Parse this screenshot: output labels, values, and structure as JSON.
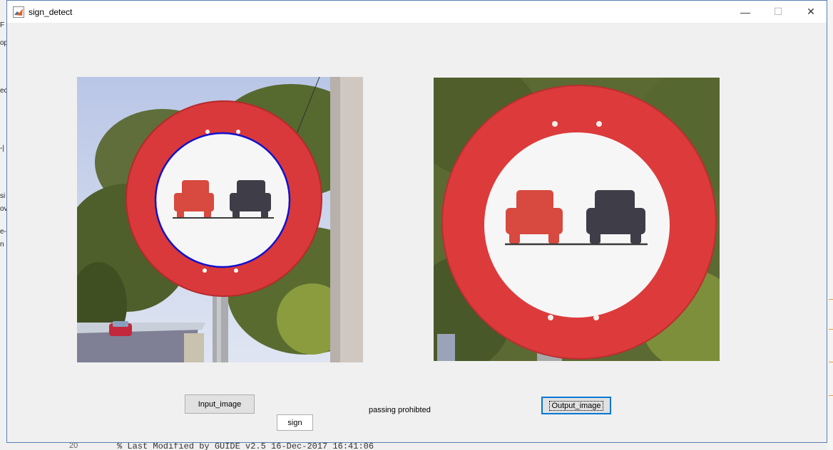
{
  "window": {
    "title": "sign_detect"
  },
  "controls": {
    "minimize": "—",
    "maximize": "☐",
    "close": "✕"
  },
  "axes_input": {
    "circle_color": "#1010d0"
  },
  "axes_output": {},
  "buttons": {
    "input_image": "Input_image",
    "sign": "sign",
    "output_image": "Output_image"
  },
  "result_text": "passing prohibted",
  "background_editor": {
    "left_fragments": [
      "F",
      "op",
      "ec",
      "-|",
      "si",
      "ov",
      "e-",
      "n"
    ],
    "bottom_code": "% Last Modified by GUIDE v2.5 16-Dec-2017 16:41:06",
    "line_number": "20"
  },
  "colors": {
    "sign_red": "#e03a3a",
    "car_red": "#d8493f",
    "car_dark": "#3f3d48",
    "focus_blue": "#0078d7"
  }
}
